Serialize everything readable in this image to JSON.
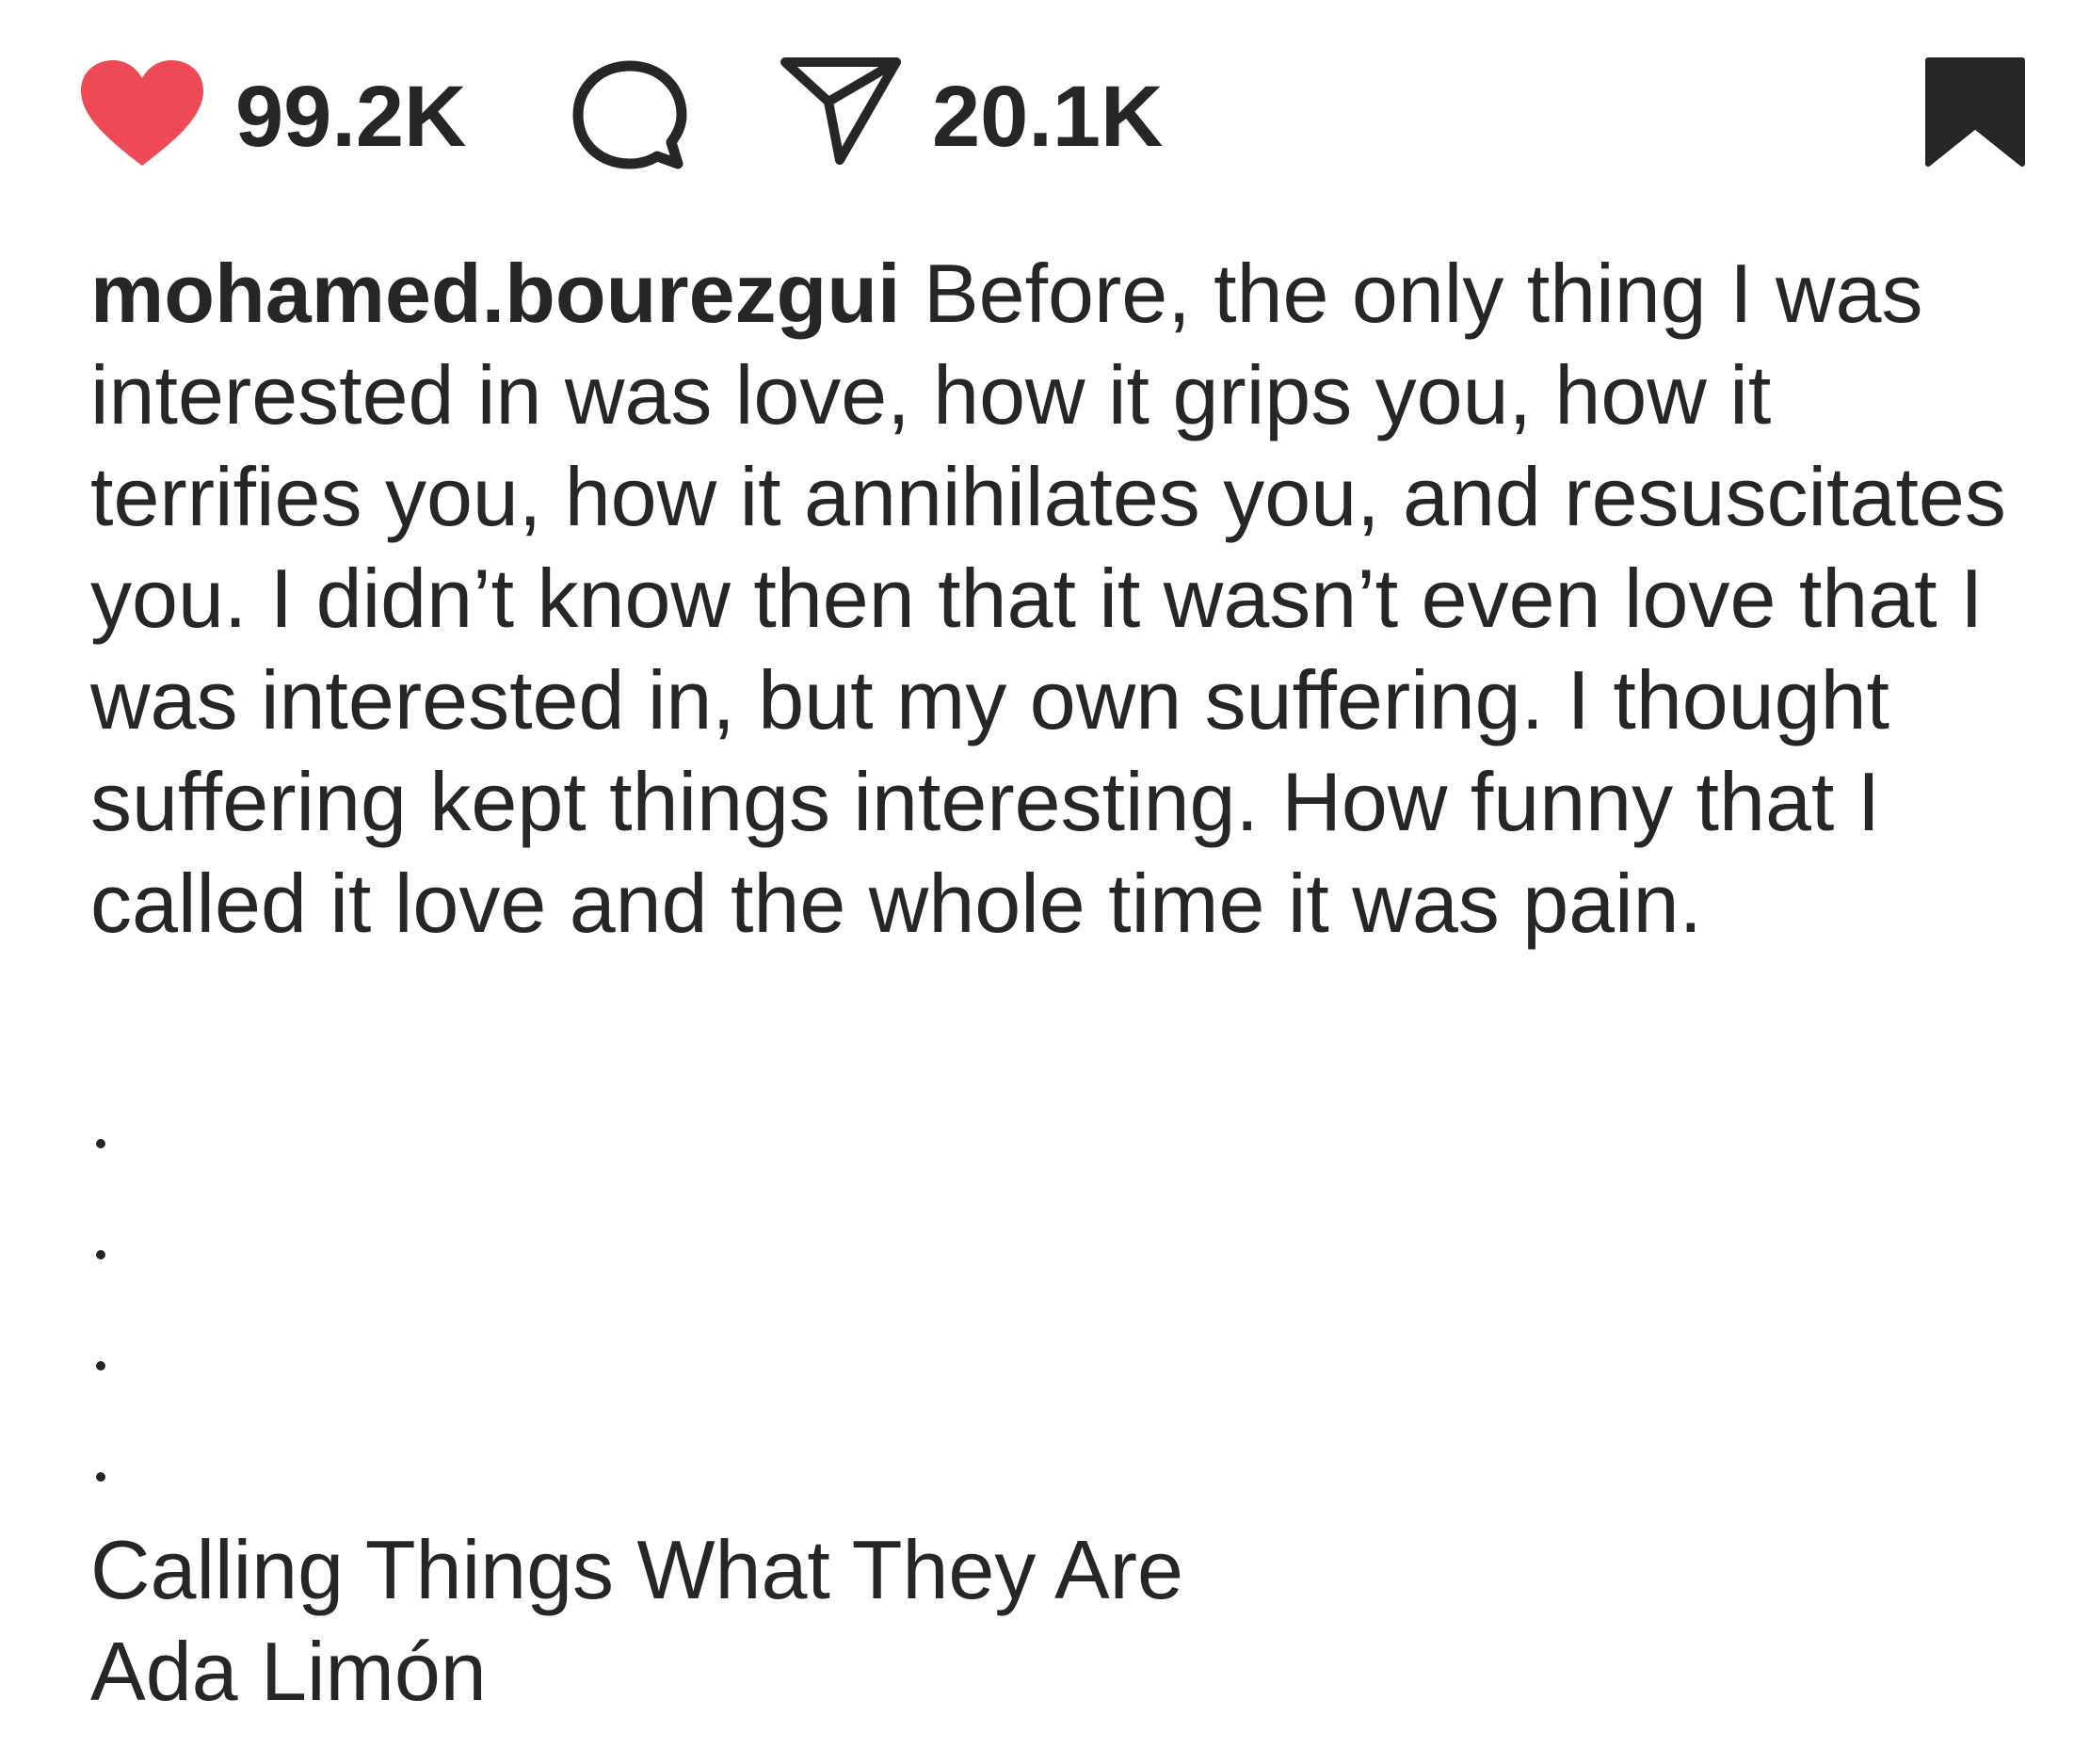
{
  "actions": {
    "likes": "99.2K",
    "shares": "20.1K",
    "like_icon": "heart-filled-icon",
    "comment_icon": "comment-bubble-icon",
    "share_icon": "paper-plane-icon",
    "save_icon": "bookmark-filled-icon",
    "like_color": "#ED4956",
    "icon_color": "#262626"
  },
  "caption": {
    "username": "mohamed.bourezgui",
    "text": "Before, the only thing I was interested in was love, how it grips you, how it terrifies you, how it annihilates you, and resuscitates you. I didn’t know then that it wasn’t even love that I was interested in, but my own suffering. I thought suffering kept things interesting. How funny that I called it love and the whole time it was pain.",
    "title": "Calling Things What They Are",
    "author": "Ada Limón"
  }
}
